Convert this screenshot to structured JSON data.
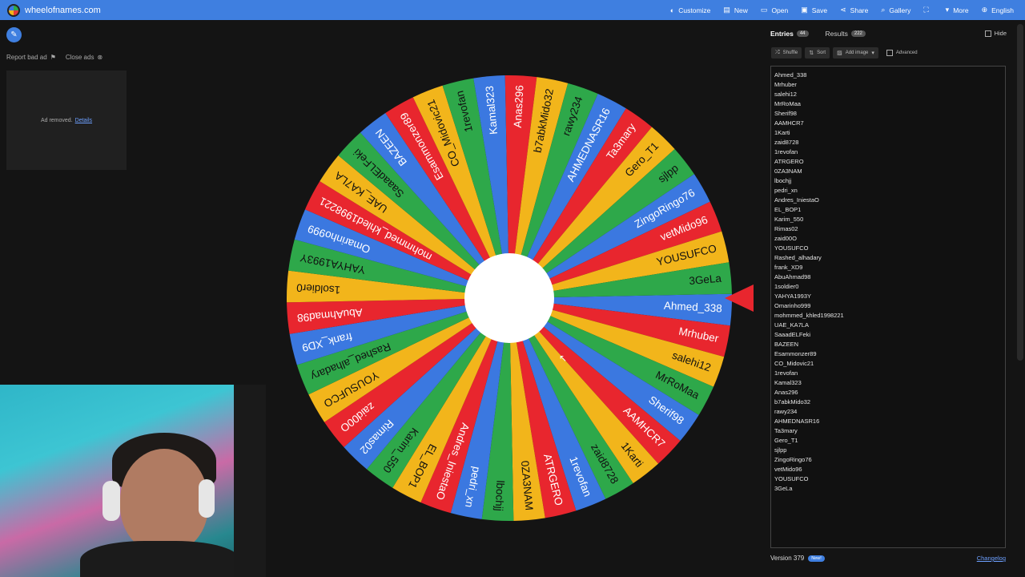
{
  "header": {
    "site_title": "wheelofnames.com",
    "nav": [
      {
        "icon": "palette-icon",
        "glyph": "◐",
        "label": "Customize"
      },
      {
        "icon": "file-icon",
        "glyph": "▤",
        "label": "New"
      },
      {
        "icon": "folder-icon",
        "glyph": "▭",
        "label": "Open"
      },
      {
        "icon": "save-icon",
        "glyph": "▣",
        "label": "Save"
      },
      {
        "icon": "share-icon",
        "glyph": "⋖",
        "label": "Share"
      },
      {
        "icon": "search-icon",
        "glyph": "⌕",
        "label": "Gallery"
      },
      {
        "icon": "fullscreen-icon",
        "glyph": "⛶",
        "label": ""
      },
      {
        "icon": "chevron-down-icon",
        "glyph": "▾",
        "label": "More"
      },
      {
        "icon": "globe-icon",
        "glyph": "⊕",
        "label": "English"
      }
    ]
  },
  "ads": {
    "report_label": "Report bad ad",
    "close_label": "Close ads",
    "removed_text": "Ad removed.",
    "details_label": "Details"
  },
  "panel": {
    "tab_entries": "Entries",
    "entries_count": "44",
    "tab_results": "Results",
    "results_count": "222",
    "hide_label": "Hide",
    "shuffle_label": "Shuffle",
    "sort_label": "Sort",
    "add_image_label": "Add image",
    "advanced_label": "Advanced",
    "version_label": "Version 379",
    "new_badge": "New!",
    "changelog_label": "Changelog"
  },
  "entries": [
    "Ahmed_338",
    "Mrhuber",
    "salehi12",
    "MrRoMaa",
    "Sherif98",
    "AAMHCR7",
    "1Karti",
    "zaid8728",
    "1revofan",
    "ATRGERO",
    "0ZA3NAM",
    "lbochjj",
    "pedri_xn",
    "Andres_IniestaO",
    "EL_BOP1",
    "Karim_550",
    "Rimas02",
    "zaid00O",
    "YOUSUFCO",
    "Rashed_alhadary",
    "frank_XD9",
    "AbuAhmad98",
    "1soldier0",
    "YAHYA1993Y",
    "Omarinho999",
    "mohmmed_khled1998221",
    "UAE_KA7LA",
    "SaaadELFeki",
    "BAZEEN",
    "Esammonzer89",
    "CO_Midovic21",
    "1revofan",
    "Kamal323",
    "Anas296",
    "b7abkMido32",
    "rawy234",
    "AHMEDNASR16",
    "Ta3mary",
    "Gero_T1",
    "sjlpp",
    "ZingoRingo76",
    "vetMido96",
    "YOUSUFCO",
    "3GeLa"
  ],
  "wheel": {
    "colors": [
      "#3b78e0",
      "#e8262e",
      "#f2b51b",
      "#2ea84a"
    ],
    "slice_count": 44
  }
}
